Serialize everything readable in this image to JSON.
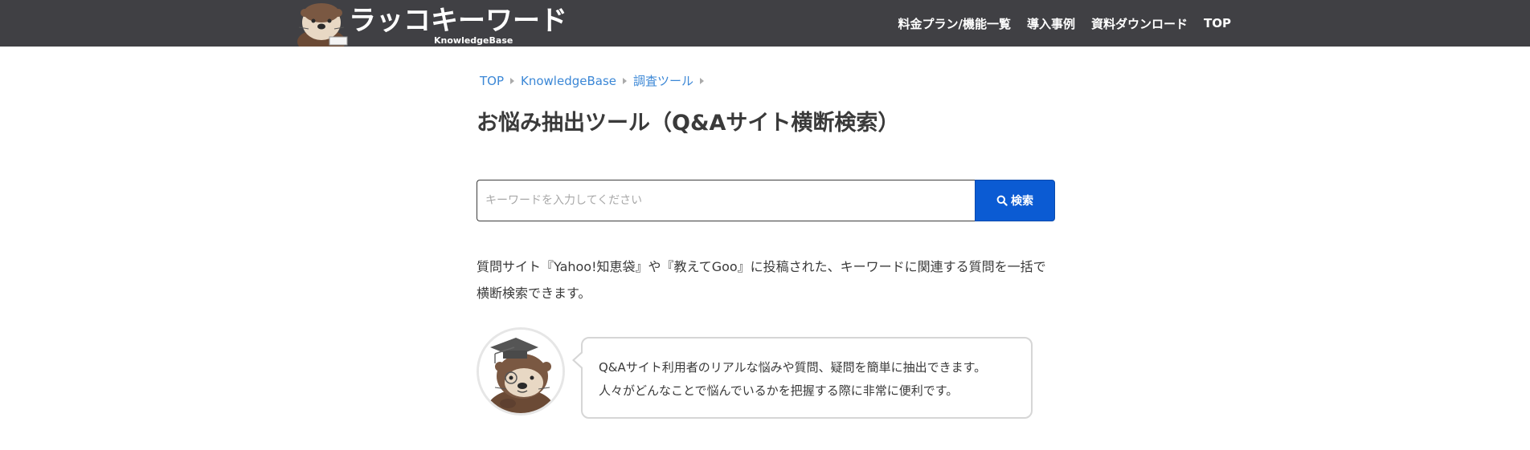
{
  "header": {
    "logo": {
      "title": "ラッコキーワード",
      "subtitle": "KnowledgeBase"
    },
    "nav": [
      {
        "label": "料金プラン/機能一覧"
      },
      {
        "label": "導入事例"
      },
      {
        "label": "資料ダウンロード"
      },
      {
        "label": "TOP"
      }
    ]
  },
  "breadcrumb": [
    {
      "label": "TOP"
    },
    {
      "label": "KnowledgeBase"
    },
    {
      "label": "調査ツール"
    }
  ],
  "page_title": "お悩み抽出ツール（Q&Aサイト横断検索）",
  "search": {
    "placeholder": "キーワードを入力してください",
    "value": "",
    "button_label": "検索",
    "button_icon": "search-icon"
  },
  "description": "質問サイト『Yahoo!知恵袋』や『教えてGoo』に投稿された、キーワードに関連する質問を一括で横断検索できます。",
  "speech": {
    "avatar": "otter-professor-avatar",
    "lines": [
      "Q&Aサイト利用者のリアルな悩みや質問、疑問を簡単に抽出できます。",
      "人々がどんなことで悩んでいるかを把握する際に非常に便利です。"
    ]
  },
  "colors": {
    "header_bg": "#404044",
    "link": "#3b87d6",
    "primary_button": "#0b5bd3",
    "text": "#3a3a3a"
  }
}
